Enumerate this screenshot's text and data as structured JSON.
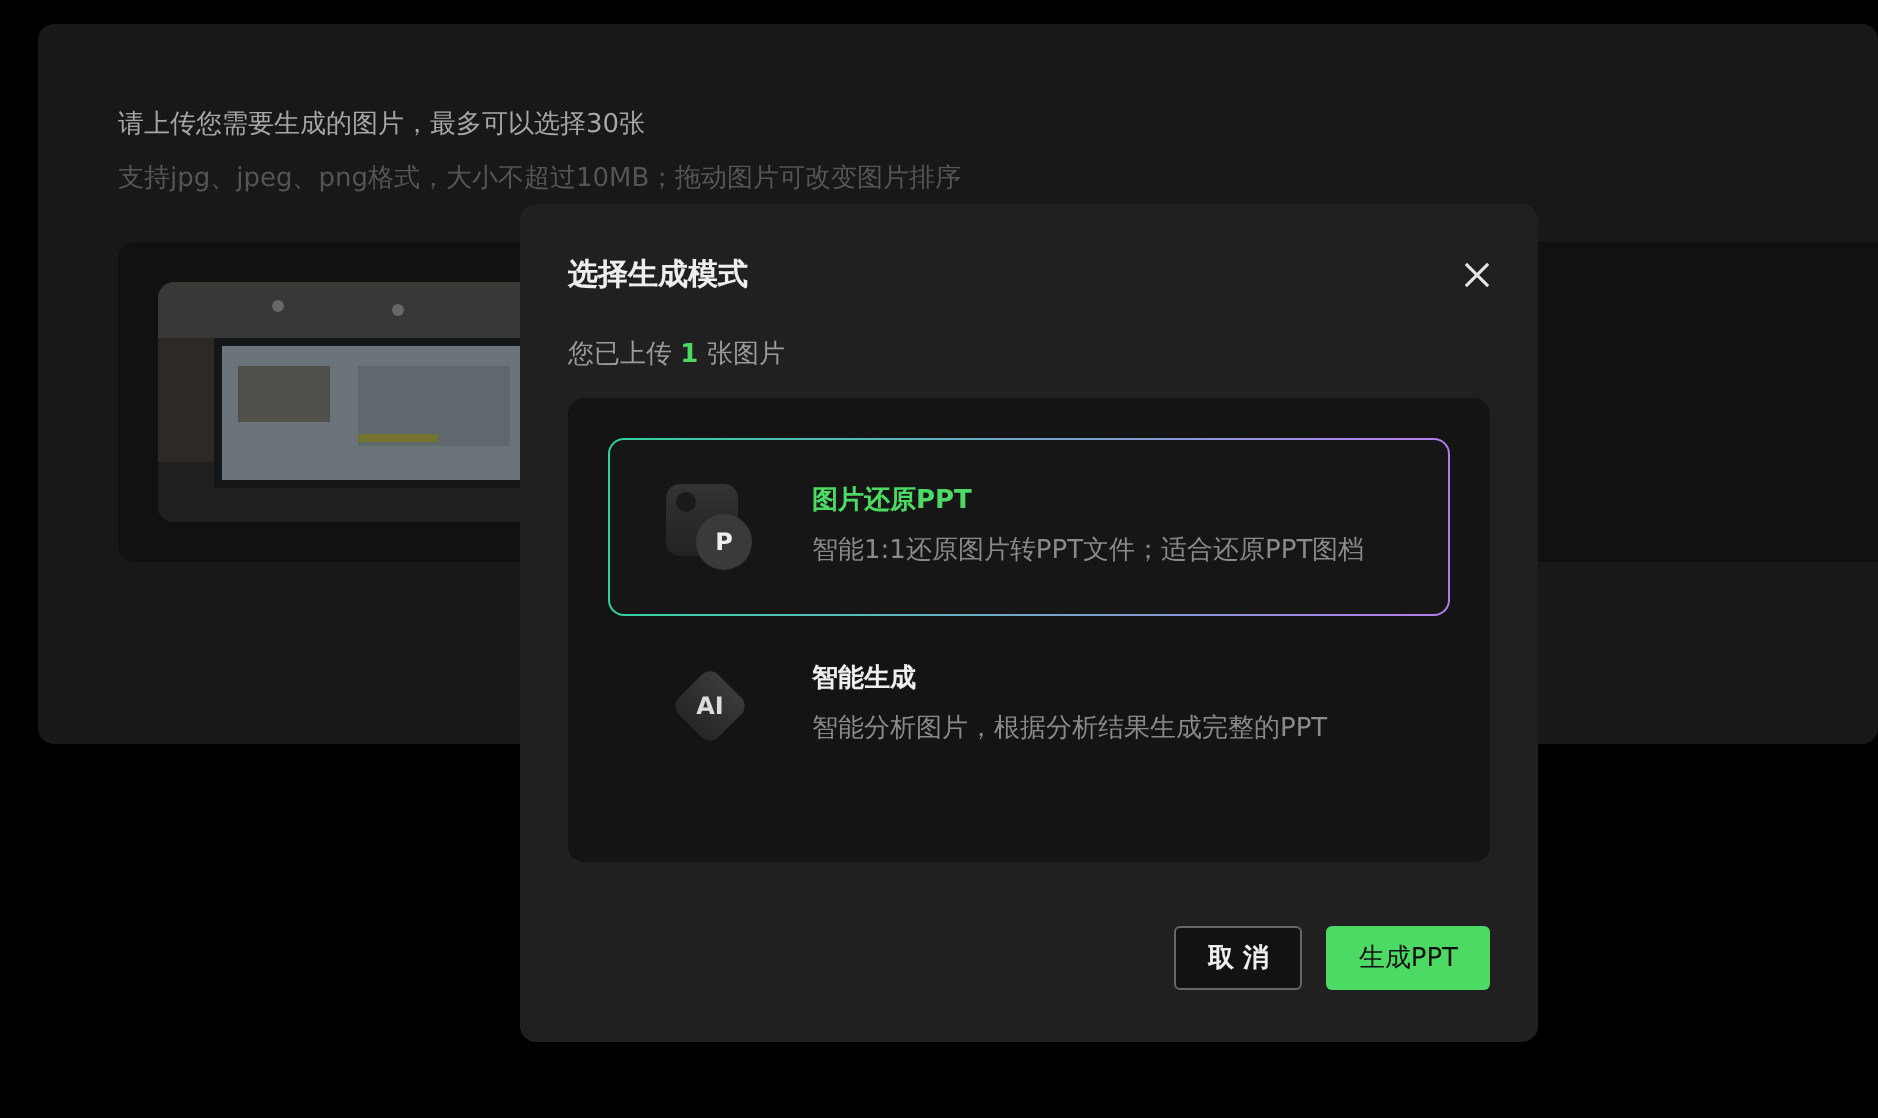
{
  "page": {
    "title": "请上传您需要生成的图片，最多可以选择30张",
    "hint": "支持jpg、jpeg、png格式，大小不超过10MB；拖动图片可改变图片排序"
  },
  "dialog": {
    "title": "选择生成模式",
    "upload_prefix": "您已上传",
    "upload_count": "1",
    "upload_suffix": "张图片",
    "modes": [
      {
        "kind": "restore",
        "badge": "P",
        "title": "图片还原PPT",
        "description": "智能1:1还原图片转PPT文件；适合还原PPT图档",
        "selected": true
      },
      {
        "kind": "ai",
        "badge": "AI",
        "title": "智能生成",
        "description": "智能分析图片，根据分析结果生成完整的PPT",
        "selected": false
      }
    ],
    "buttons": [
      {
        "kind": "secondary",
        "label": "取 消"
      },
      {
        "kind": "primary",
        "label": "生成PPT"
      }
    ]
  }
}
